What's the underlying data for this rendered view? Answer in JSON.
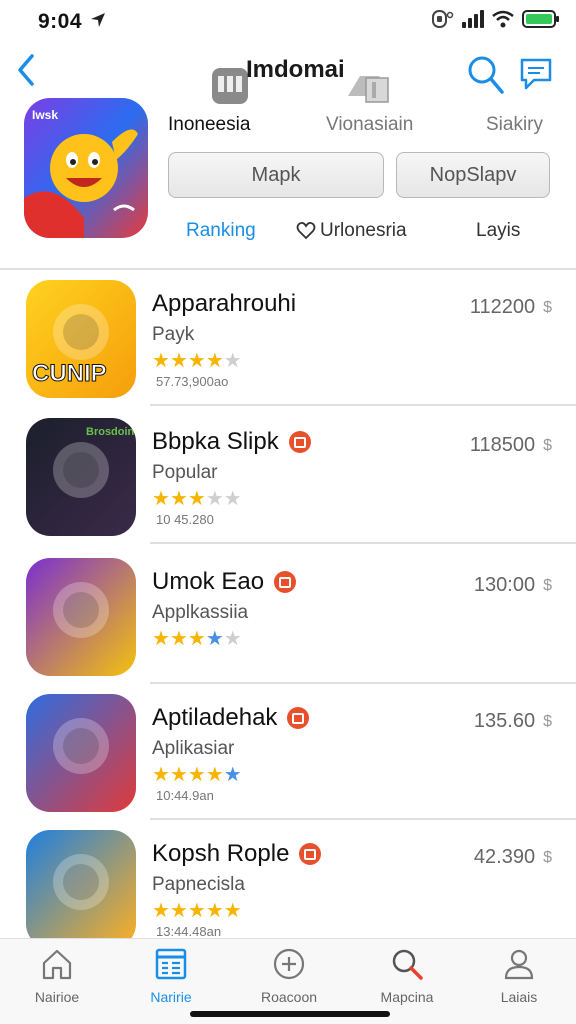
{
  "status_bar": {
    "time": "9:04"
  },
  "header": {
    "title": "Imdomai"
  },
  "hero": {
    "badge": "Iwsk"
  },
  "location_tabs": [
    "Inoneesia",
    "Vionasiain",
    "Siakiry"
  ],
  "segments": [
    "Mapk",
    "NopSlapv"
  ],
  "filters": [
    "Ranking",
    "Urlonesria",
    "Layis"
  ],
  "apps": [
    {
      "name": "Apparahrouhi",
      "subtitle": "Payk",
      "rating": 4,
      "stars": "★★★★★",
      "meta": "57.73,900ao",
      "price": "112200",
      "badge": false,
      "icon_text": "CUNIP"
    },
    {
      "name": "Bbpka Slipk",
      "subtitle": "Popular",
      "rating": 3,
      "stars": "★★★★★",
      "meta": "10 45.280",
      "price": "118500",
      "badge": true,
      "icon_text": "Brosdoin"
    },
    {
      "name": "Umok Eao",
      "subtitle": "Applkassiia",
      "rating": 3,
      "stars": "★★★★☆",
      "meta": "",
      "price": "130:00",
      "badge": true,
      "icon_text": ""
    },
    {
      "name": "Aptiladehak",
      "subtitle": "Aplikasiar",
      "rating": 4,
      "stars": "★★★★☆",
      "meta": "10:44.9an",
      "price": "135.60",
      "badge": true,
      "icon_text": ""
    },
    {
      "name": "Kopsh Rople",
      "subtitle": "Papnecisla",
      "rating": 5,
      "stars": "★★★★★",
      "meta": "13:44.48an",
      "price": "42.390",
      "badge": true,
      "icon_text": ""
    }
  ],
  "price_symbol": "$",
  "tab_bar": [
    {
      "label": "Nairioe",
      "icon": "home-icon",
      "active": false
    },
    {
      "label": "Naririe",
      "icon": "browse-icon",
      "active": true
    },
    {
      "label": "Roacoon",
      "icon": "add-icon",
      "active": false
    },
    {
      "label": "Mapcina",
      "icon": "search-icon",
      "active": false
    },
    {
      "label": "Laiais",
      "icon": "person-icon",
      "active": false
    }
  ],
  "colors": {
    "accent": "#1a8ee6",
    "star": "#f7b500",
    "badge": "#e8502c"
  }
}
